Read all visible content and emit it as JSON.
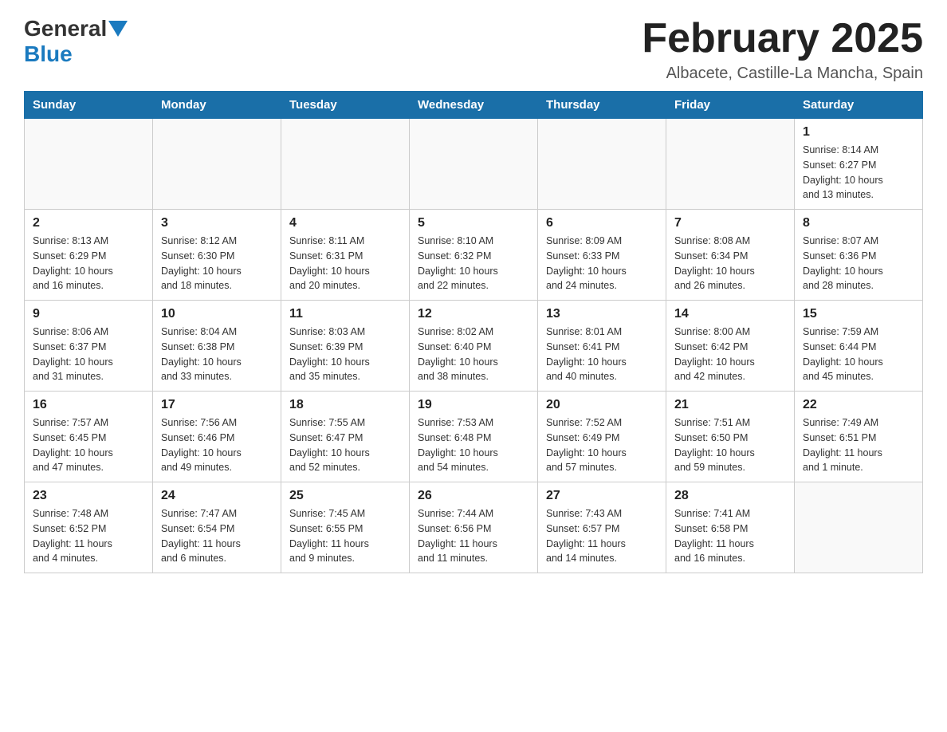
{
  "header": {
    "logo": {
      "general": "General",
      "blue": "Blue"
    },
    "title": "February 2025",
    "subtitle": "Albacete, Castille-La Mancha, Spain"
  },
  "days_of_week": [
    "Sunday",
    "Monday",
    "Tuesday",
    "Wednesday",
    "Thursday",
    "Friday",
    "Saturday"
  ],
  "weeks": [
    {
      "days": [
        {
          "number": "",
          "info": ""
        },
        {
          "number": "",
          "info": ""
        },
        {
          "number": "",
          "info": ""
        },
        {
          "number": "",
          "info": ""
        },
        {
          "number": "",
          "info": ""
        },
        {
          "number": "",
          "info": ""
        },
        {
          "number": "1",
          "info": "Sunrise: 8:14 AM\nSunset: 6:27 PM\nDaylight: 10 hours\nand 13 minutes."
        }
      ]
    },
    {
      "days": [
        {
          "number": "2",
          "info": "Sunrise: 8:13 AM\nSunset: 6:29 PM\nDaylight: 10 hours\nand 16 minutes."
        },
        {
          "number": "3",
          "info": "Sunrise: 8:12 AM\nSunset: 6:30 PM\nDaylight: 10 hours\nand 18 minutes."
        },
        {
          "number": "4",
          "info": "Sunrise: 8:11 AM\nSunset: 6:31 PM\nDaylight: 10 hours\nand 20 minutes."
        },
        {
          "number": "5",
          "info": "Sunrise: 8:10 AM\nSunset: 6:32 PM\nDaylight: 10 hours\nand 22 minutes."
        },
        {
          "number": "6",
          "info": "Sunrise: 8:09 AM\nSunset: 6:33 PM\nDaylight: 10 hours\nand 24 minutes."
        },
        {
          "number": "7",
          "info": "Sunrise: 8:08 AM\nSunset: 6:34 PM\nDaylight: 10 hours\nand 26 minutes."
        },
        {
          "number": "8",
          "info": "Sunrise: 8:07 AM\nSunset: 6:36 PM\nDaylight: 10 hours\nand 28 minutes."
        }
      ]
    },
    {
      "days": [
        {
          "number": "9",
          "info": "Sunrise: 8:06 AM\nSunset: 6:37 PM\nDaylight: 10 hours\nand 31 minutes."
        },
        {
          "number": "10",
          "info": "Sunrise: 8:04 AM\nSunset: 6:38 PM\nDaylight: 10 hours\nand 33 minutes."
        },
        {
          "number": "11",
          "info": "Sunrise: 8:03 AM\nSunset: 6:39 PM\nDaylight: 10 hours\nand 35 minutes."
        },
        {
          "number": "12",
          "info": "Sunrise: 8:02 AM\nSunset: 6:40 PM\nDaylight: 10 hours\nand 38 minutes."
        },
        {
          "number": "13",
          "info": "Sunrise: 8:01 AM\nSunset: 6:41 PM\nDaylight: 10 hours\nand 40 minutes."
        },
        {
          "number": "14",
          "info": "Sunrise: 8:00 AM\nSunset: 6:42 PM\nDaylight: 10 hours\nand 42 minutes."
        },
        {
          "number": "15",
          "info": "Sunrise: 7:59 AM\nSunset: 6:44 PM\nDaylight: 10 hours\nand 45 minutes."
        }
      ]
    },
    {
      "days": [
        {
          "number": "16",
          "info": "Sunrise: 7:57 AM\nSunset: 6:45 PM\nDaylight: 10 hours\nand 47 minutes."
        },
        {
          "number": "17",
          "info": "Sunrise: 7:56 AM\nSunset: 6:46 PM\nDaylight: 10 hours\nand 49 minutes."
        },
        {
          "number": "18",
          "info": "Sunrise: 7:55 AM\nSunset: 6:47 PM\nDaylight: 10 hours\nand 52 minutes."
        },
        {
          "number": "19",
          "info": "Sunrise: 7:53 AM\nSunset: 6:48 PM\nDaylight: 10 hours\nand 54 minutes."
        },
        {
          "number": "20",
          "info": "Sunrise: 7:52 AM\nSunset: 6:49 PM\nDaylight: 10 hours\nand 57 minutes."
        },
        {
          "number": "21",
          "info": "Sunrise: 7:51 AM\nSunset: 6:50 PM\nDaylight: 10 hours\nand 59 minutes."
        },
        {
          "number": "22",
          "info": "Sunrise: 7:49 AM\nSunset: 6:51 PM\nDaylight: 11 hours\nand 1 minute."
        }
      ]
    },
    {
      "days": [
        {
          "number": "23",
          "info": "Sunrise: 7:48 AM\nSunset: 6:52 PM\nDaylight: 11 hours\nand 4 minutes."
        },
        {
          "number": "24",
          "info": "Sunrise: 7:47 AM\nSunset: 6:54 PM\nDaylight: 11 hours\nand 6 minutes."
        },
        {
          "number": "25",
          "info": "Sunrise: 7:45 AM\nSunset: 6:55 PM\nDaylight: 11 hours\nand 9 minutes."
        },
        {
          "number": "26",
          "info": "Sunrise: 7:44 AM\nSunset: 6:56 PM\nDaylight: 11 hours\nand 11 minutes."
        },
        {
          "number": "27",
          "info": "Sunrise: 7:43 AM\nSunset: 6:57 PM\nDaylight: 11 hours\nand 14 minutes."
        },
        {
          "number": "28",
          "info": "Sunrise: 7:41 AM\nSunset: 6:58 PM\nDaylight: 11 hours\nand 16 minutes."
        },
        {
          "number": "",
          "info": ""
        }
      ]
    }
  ]
}
